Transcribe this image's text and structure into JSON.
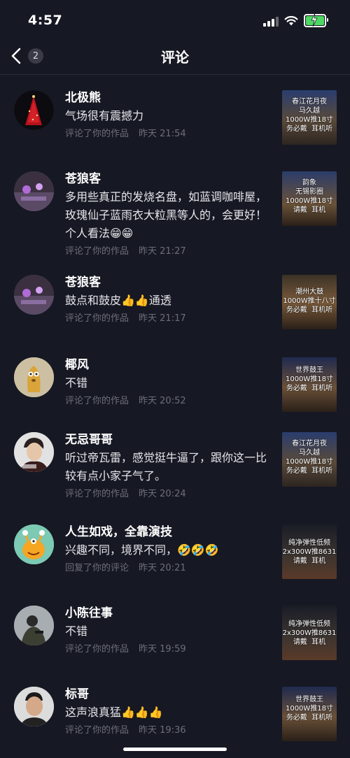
{
  "status_bar": {
    "time": "4:57"
  },
  "nav": {
    "back_count": "2",
    "title": "评论"
  },
  "comments": [
    {
      "username": "北极熊",
      "text": "气场很有震撼力",
      "action": "评论了你的作品",
      "time": "昨天 21:54",
      "thumb_text": "春江花月夜\n马久越\n1000W推18寸\n务必戴  耳机听"
    },
    {
      "username": "苍狼客",
      "text": "多用些真正的发烧名盘，如蓝调咖啡屋，玫瑰仙子蓝雨衣大粒黑等人的，会更好！个人看法😁😁",
      "action": "评论了你的作品",
      "time": "昨天 21:27",
      "thumb_text": "韵象\n无锡影圈\n1000W推18寸\n请戴  耳机"
    },
    {
      "username": "苍狼客",
      "text": "鼓点和鼓皮👍👍通透",
      "action": "评论了你的作品",
      "time": "昨天 21:17",
      "thumb_text": "潮州大鼓\n1000W推十八寸\n务必戴  耳机听"
    },
    {
      "username": "椰风",
      "text": "不错",
      "action": "评论了你的作品",
      "time": "昨天 20:52",
      "thumb_text": "世界鼓王\n1000W推18寸\n务必戴  耳机听"
    },
    {
      "username": "无忌哥哥",
      "text": "听过帝瓦雷，感觉挺牛逼了，跟你这一比较有点小家子气了。",
      "action": "评论了你的作品",
      "time": "昨天 20:24",
      "thumb_text": "春江花月夜\n马久越\n1000W推18寸\n务必戴  耳机听"
    },
    {
      "username": "人生如戏，全靠演技",
      "text": "兴趣不同，境界不同，🤣🤣🤣",
      "action": "回复了你的评论",
      "time": "昨天 20:21",
      "thumb_text": "纯净弹性低频\n2x300W推8631\n请戴  耳机"
    },
    {
      "username": "小陈往事",
      "text": "不错",
      "action": "评论了你的作品",
      "time": "昨天 19:59",
      "thumb_text": "纯净弹性低频\n2x300W推8631\n请戴  耳机"
    },
    {
      "username": "标哥",
      "text": "这声浪真猛👍👍👍",
      "action": "评论了你的作品",
      "time": "昨天 19:36",
      "thumb_text": "世界鼓王\n1000W推18寸\n务必戴  耳机听"
    }
  ],
  "colors": {
    "background": "#161823",
    "meta": "#6d6e78",
    "battery": "#4cd964"
  }
}
